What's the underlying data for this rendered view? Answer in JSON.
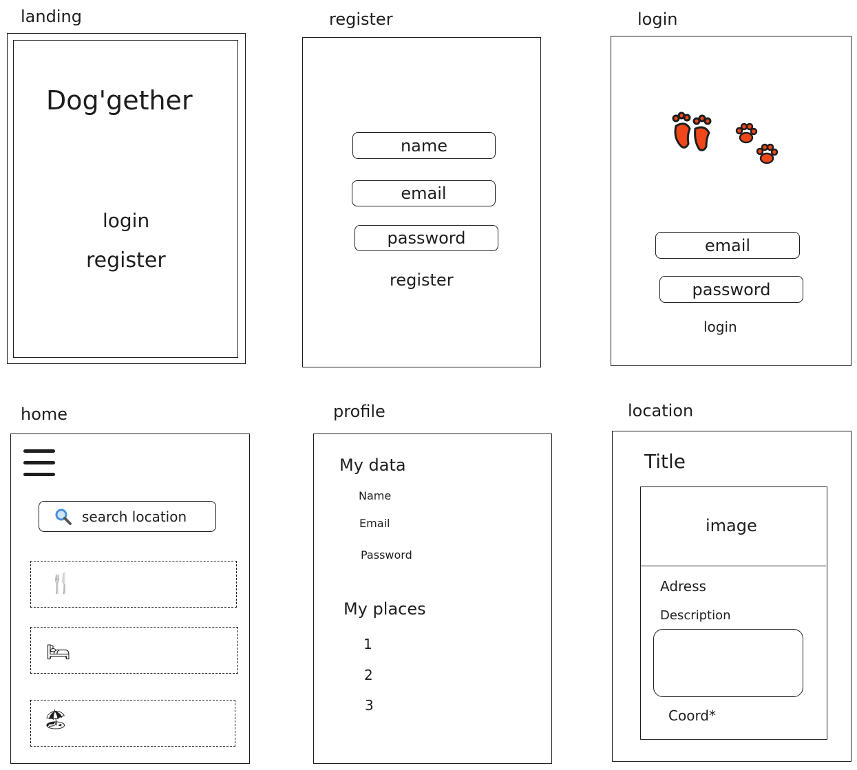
{
  "screens": {
    "landing": {
      "caption": "landing",
      "app_title": "Dog'gether",
      "login_link": "login",
      "register_link": "register"
    },
    "register": {
      "caption": "register",
      "name_field": "name",
      "email_field": "email",
      "password_field": "password",
      "register_link": "register"
    },
    "login": {
      "caption": "login",
      "email_field": "email",
      "password_field": "password",
      "login_link": "login"
    },
    "home": {
      "caption": "home",
      "search_label": "search location",
      "categories": [
        {
          "icon": "fork-and-knife-icon",
          "glyph": "🍴"
        },
        {
          "icon": "bed-icon",
          "glyph": "🛏"
        },
        {
          "icon": "beach-umbrella-icon",
          "glyph": "🏖"
        }
      ]
    },
    "profile": {
      "caption": "profile",
      "my_data_heading": "My data",
      "data_fields": [
        "Name",
        "Email",
        "Password"
      ],
      "my_places_heading": "My places",
      "places": [
        "1",
        "2",
        "3"
      ]
    },
    "location": {
      "caption": "location",
      "title": "Title",
      "image_label": "image",
      "address_label": "Adress",
      "description_label": "Description",
      "coord_label": "Coord*"
    }
  },
  "icons": {
    "footprints": "footprints-icon",
    "paws": "paw-prints-icon",
    "hamburger": "hamburger-menu-icon",
    "search": "magnifier-icon"
  },
  "colors": {
    "ink": "#1e1e1e",
    "paw_orange": "#f0471a",
    "magnifier_blue": "#4a90d9"
  }
}
